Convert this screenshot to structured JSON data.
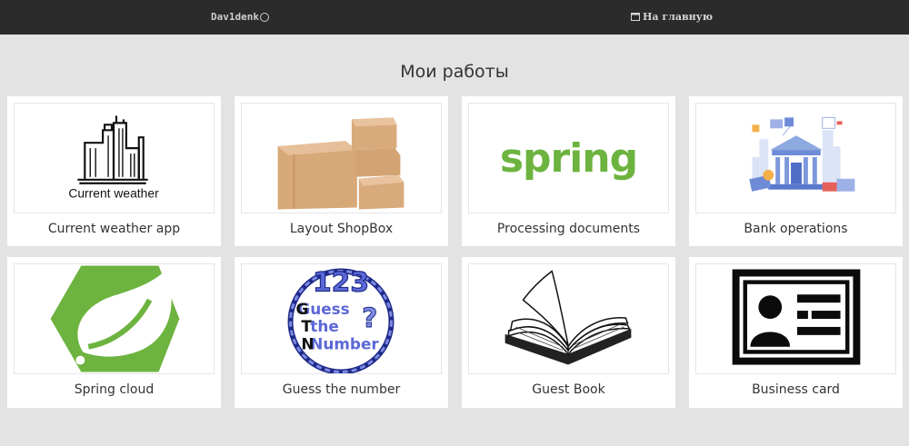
{
  "nav": {
    "brand": "Dav1denk",
    "home_label": "На главную"
  },
  "page": {
    "title": "Мои работы"
  },
  "cards": [
    {
      "title": "Current weather app",
      "image_text": "Current weather",
      "image": "city-skyline"
    },
    {
      "title": "Layout ShopBox",
      "image": "cardboard-boxes"
    },
    {
      "title": "Processing documents",
      "image_text": "spring",
      "image": "spring-logo"
    },
    {
      "title": "Bank operations",
      "image": "bank-illustration"
    },
    {
      "title": "Spring cloud",
      "image": "spring-leaf-hexagon"
    },
    {
      "title": "Guess the number",
      "image_text": [
        "123",
        "Guess",
        "the",
        "Number",
        "?",
        "G",
        "T",
        "N"
      ],
      "image": "rope-circle-logo"
    },
    {
      "title": "Guest Book",
      "image": "open-book"
    },
    {
      "title": "Business card",
      "image": "id-card"
    }
  ],
  "colors": {
    "navbar": "#2b2b2b",
    "background": "#e3e3e3",
    "spring_green": "#6db33f",
    "guess_blue": "#4a55c8"
  }
}
